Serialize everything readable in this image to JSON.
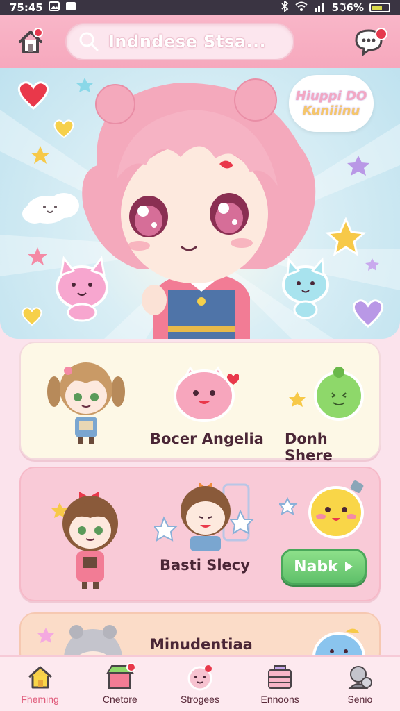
{
  "status_bar": {
    "time": "75:45",
    "battery": "5ℑ6%"
  },
  "header": {
    "search_text": "Indndese Stsa..."
  },
  "hero": {
    "tag_line1": "Hiuppi DO",
    "tag_line2": "Kuniiinu"
  },
  "cards": [
    {
      "labels": [
        "Bocer Angelia",
        "Donh Shere"
      ]
    },
    {
      "labels": [
        "Basti Slecy"
      ],
      "button_label": "Nabk"
    },
    {
      "labels": [
        "Minudentiaa"
      ]
    }
  ],
  "bottom_nav": {
    "items": [
      {
        "label": "Fheming",
        "icon": "home-icon"
      },
      {
        "label": "Cnetore",
        "icon": "store-icon"
      },
      {
        "label": "Strogees",
        "icon": "pet-icon"
      },
      {
        "label": "Ennoons",
        "icon": "gift-box-icon"
      },
      {
        "label": "Senio",
        "icon": "settings-icon"
      }
    ]
  },
  "colors": {
    "header_pink": "#f6a8bd",
    "accent_pink": "#e05a7a",
    "button_green": "#5fc06a",
    "notification_red": "#e5394e"
  }
}
